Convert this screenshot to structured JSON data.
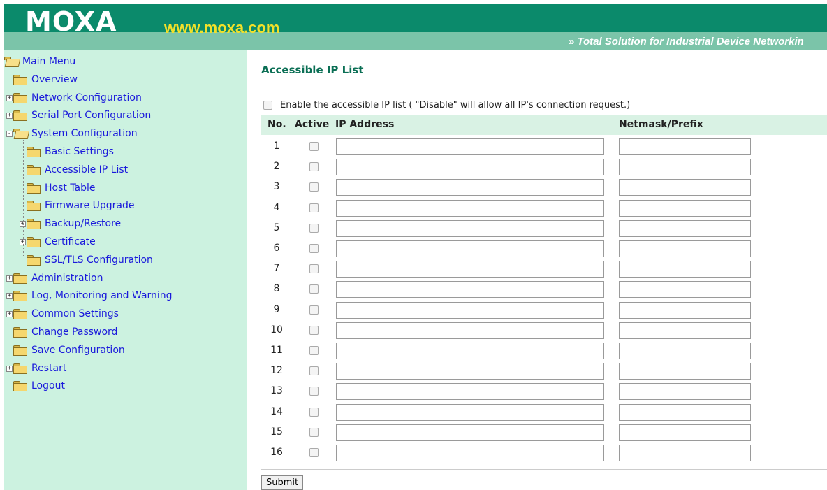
{
  "header": {
    "logo": "MOXA",
    "url": "www.moxa.com",
    "tagline": "Total Solution for Industrial Device Networkin",
    "tagline_icon": "double-chevron-right-icon"
  },
  "sidebar": {
    "items": [
      {
        "label": "Main Menu",
        "toggle": "",
        "open": true
      },
      {
        "label": "Overview",
        "toggle": ""
      },
      {
        "label": "Network Configuration",
        "toggle": "+"
      },
      {
        "label": "Serial Port Configuration",
        "toggle": "+"
      },
      {
        "label": "System Configuration",
        "toggle": "-",
        "open": true
      },
      {
        "label": "Basic Settings",
        "toggle": ""
      },
      {
        "label": "Accessible IP List",
        "toggle": ""
      },
      {
        "label": "Host Table",
        "toggle": ""
      },
      {
        "label": "Firmware Upgrade",
        "toggle": ""
      },
      {
        "label": "Backup/Restore",
        "toggle": "+"
      },
      {
        "label": "Certificate",
        "toggle": "+"
      },
      {
        "label": "SSL/TLS Configuration",
        "toggle": ""
      },
      {
        "label": "Administration",
        "toggle": "+"
      },
      {
        "label": "Log, Monitoring and Warning",
        "toggle": "+"
      },
      {
        "label": "Common Settings",
        "toggle": "+"
      },
      {
        "label": "Change Password",
        "toggle": ""
      },
      {
        "label": "Save Configuration",
        "toggle": ""
      },
      {
        "label": "Restart",
        "toggle": "+"
      },
      {
        "label": "Logout",
        "toggle": ""
      }
    ]
  },
  "main": {
    "title": "Accessible IP List",
    "enable_label": "Enable the accessible IP list ( \"Disable\" will allow all IP's connection request.)",
    "enable_checked": false,
    "columns": {
      "no": "No.",
      "active": "Active",
      "ip": "IP Address",
      "mask": "Netmask/Prefix"
    },
    "rows": [
      {
        "no": "1",
        "active": false,
        "ip": "",
        "mask": ""
      },
      {
        "no": "2",
        "active": false,
        "ip": "",
        "mask": ""
      },
      {
        "no": "3",
        "active": false,
        "ip": "",
        "mask": ""
      },
      {
        "no": "4",
        "active": false,
        "ip": "",
        "mask": ""
      },
      {
        "no": "5",
        "active": false,
        "ip": "",
        "mask": ""
      },
      {
        "no": "6",
        "active": false,
        "ip": "",
        "mask": ""
      },
      {
        "no": "7",
        "active": false,
        "ip": "",
        "mask": ""
      },
      {
        "no": "8",
        "active": false,
        "ip": "",
        "mask": ""
      },
      {
        "no": "9",
        "active": false,
        "ip": "",
        "mask": ""
      },
      {
        "no": "10",
        "active": false,
        "ip": "",
        "mask": ""
      },
      {
        "no": "11",
        "active": false,
        "ip": "",
        "mask": ""
      },
      {
        "no": "12",
        "active": false,
        "ip": "",
        "mask": ""
      },
      {
        "no": "13",
        "active": false,
        "ip": "",
        "mask": ""
      },
      {
        "no": "14",
        "active": false,
        "ip": "",
        "mask": ""
      },
      {
        "no": "15",
        "active": false,
        "ip": "",
        "mask": ""
      },
      {
        "no": "16",
        "active": false,
        "ip": "",
        "mask": ""
      }
    ],
    "submit_label": "Submit"
  }
}
